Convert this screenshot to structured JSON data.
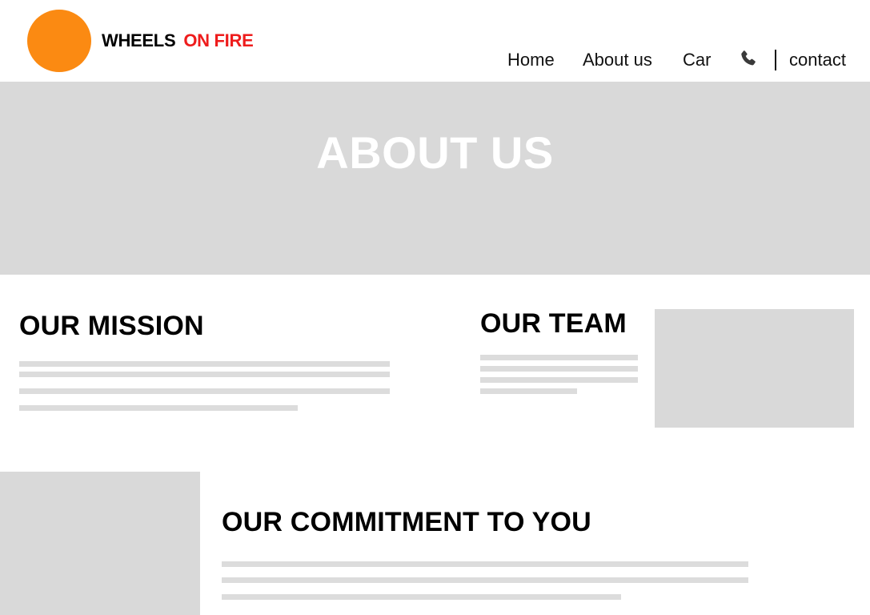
{
  "header": {
    "brand_part1": "WHEELS",
    "brand_part2": "ON FIRE",
    "logo_color": "#fb8a12",
    "brand_accent_color": "#ee1c1c"
  },
  "nav": {
    "home": "Home",
    "about": "About us",
    "car": "Car",
    "phone_icon": "phone-icon",
    "contact": "contact"
  },
  "hero": {
    "title": "ABOUT US",
    "background_color": "#d9d9d9"
  },
  "sections": {
    "mission": {
      "title": "OUR MISSION"
    },
    "team": {
      "title": "OUR TEAM"
    },
    "commitment": {
      "title": "OUR COMMITMENT TO YOU"
    }
  }
}
